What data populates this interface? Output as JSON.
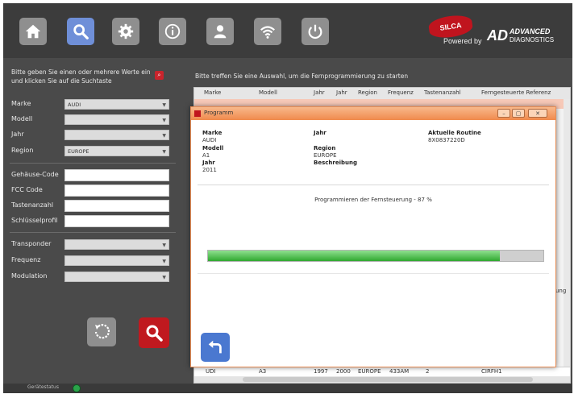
{
  "toolbar": {
    "buttons": [
      {
        "icon": "home-icon"
      },
      {
        "icon": "search-icon",
        "active": true
      },
      {
        "icon": "gear-icon"
      },
      {
        "icon": "info-icon"
      },
      {
        "icon": "user-icon"
      },
      {
        "icon": "wifi-icon"
      },
      {
        "icon": "power-icon"
      }
    ]
  },
  "brand": {
    "logo": "SILCA",
    "powered_by": "Powered by",
    "ad": "AD",
    "advanced": "ADVANCED",
    "diagnostics": "DIAGNOSTICS"
  },
  "search": {
    "instruction": "Bitte geben Sie einen oder mehrere Werte ein und klicken Sie auf die Suchtaste",
    "fields": {
      "marke": {
        "label": "Marke",
        "value": "AUDI"
      },
      "modell": {
        "label": "Modell",
        "value": ""
      },
      "jahr": {
        "label": "Jahr",
        "value": ""
      },
      "region": {
        "label": "Region",
        "value": "EUROPE"
      },
      "gehaeuse": {
        "label": "Gehäuse-Code",
        "value": ""
      },
      "fcc": {
        "label": "FCC Code",
        "value": ""
      },
      "tasten": {
        "label": "Tastenanzahl",
        "value": ""
      },
      "profil": {
        "label": "Schlüsselprofil",
        "value": ""
      },
      "transponder": {
        "label": "Transponder",
        "value": ""
      },
      "frequenz": {
        "label": "Frequenz",
        "value": ""
      },
      "modulation": {
        "label": "Modulation",
        "value": ""
      }
    }
  },
  "results": {
    "heading": "Bitte treffen Sie eine Auswahl, um die Fernprogrammierung zu starten",
    "columns": [
      "Marke",
      "Modell",
      "Jahr",
      "Jahr",
      "Region",
      "Frequenz",
      "Tastenanzahl",
      "Ferngesteuerte Referenz"
    ],
    "visible_row": [
      "UDI",
      "A3",
      "1997",
      "2000",
      "EUROPE",
      "433AM",
      "2",
      "CIRFH1"
    ],
    "peek_text": "ung"
  },
  "modal": {
    "title": "Programm",
    "window_buttons": {
      "minimize": "–",
      "maximize": "▢",
      "close": "✕"
    },
    "labels": {
      "marke": "Marke",
      "modell": "Modell",
      "jahr": "Jahr",
      "jahr2": "Jahr",
      "region": "Region",
      "beschreibung": "Beschreibung",
      "routine": "Aktuelle Routine"
    },
    "values": {
      "marke": "AUDI",
      "modell": "A1",
      "jahr": "2011",
      "region": "EUROPE",
      "routine": "8X0837220D"
    },
    "progress_text": "Programmieren der Fernsteuerung - 87 %",
    "progress": 0.87
  },
  "status": {
    "label": "Gerätestatus",
    "color": "#2aa44a"
  },
  "colors": {
    "accent_blue": "#6f8fd8",
    "search_red": "#c0191f",
    "title_orange": "#f08a4c"
  }
}
